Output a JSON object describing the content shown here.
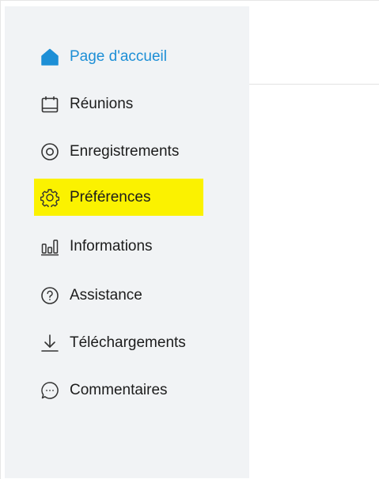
{
  "nav": {
    "items": [
      {
        "label": "Page d'accueil",
        "icon": "home-icon",
        "active": true
      },
      {
        "label": "Réunions",
        "icon": "calendar-icon"
      },
      {
        "label": "Enregistrements",
        "icon": "recording-icon"
      },
      {
        "label": "Préférences",
        "icon": "gear-icon",
        "highlighted": true
      },
      {
        "label": "Informations",
        "icon": "bar-chart-icon"
      },
      {
        "label": "Assistance",
        "icon": "help-icon"
      },
      {
        "label": "Téléchargements",
        "icon": "download-icon"
      },
      {
        "label": "Commentaires",
        "icon": "chat-bubble-icon"
      }
    ]
  },
  "colors": {
    "accent": "#1d8fd6",
    "highlight": "#fbf200",
    "sidebar_bg": "#f1f3f5",
    "text": "#1c1c1c"
  }
}
